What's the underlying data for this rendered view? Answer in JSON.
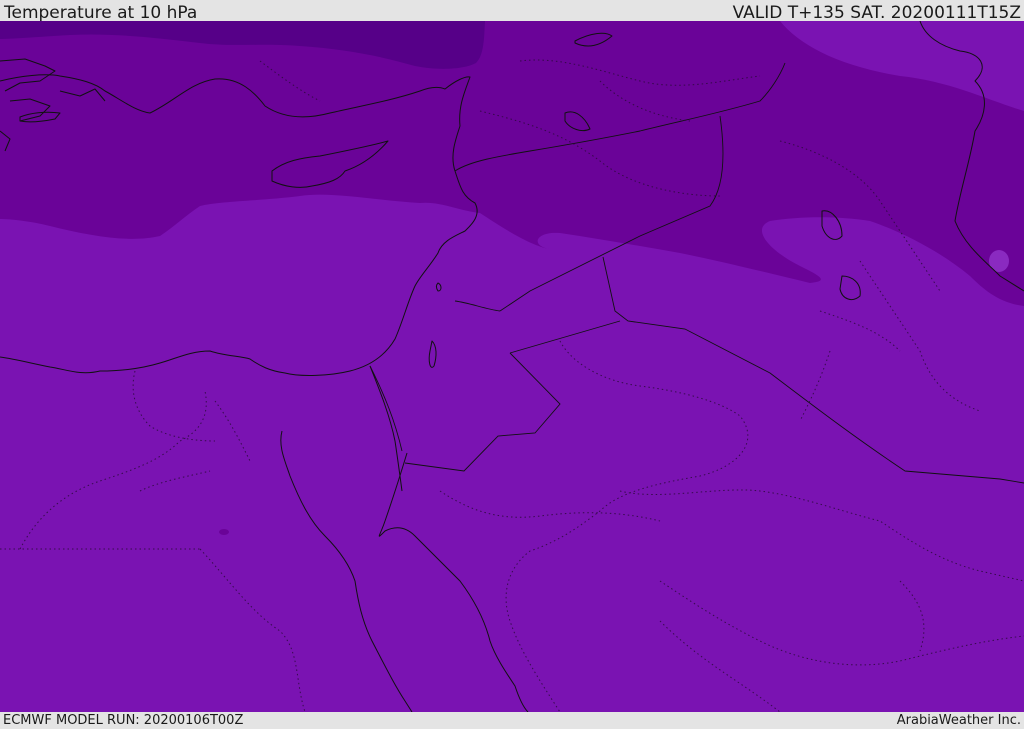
{
  "header": {
    "title": "Temperature at 10 hPa",
    "valid": "VALID T+135 SAT. 20200111T15Z"
  },
  "footer": {
    "model_run": "ECMWF MODEL RUN: 20200106T00Z",
    "credit": "ArabiaWeather Inc."
  },
  "colors": {
    "band_coldest": "#560088",
    "band_cold": "#6a0398",
    "band_base": "#7a13b2",
    "coastline": "#111111",
    "frame": "#e4e4e4"
  }
}
